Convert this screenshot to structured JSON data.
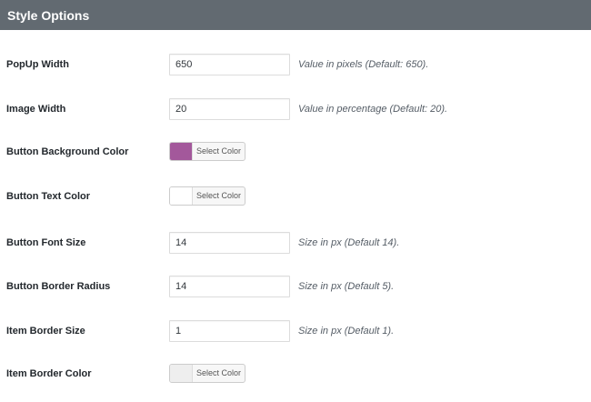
{
  "header": {
    "title": "Style Options"
  },
  "fields": [
    {
      "label": "PopUp Width",
      "type": "text",
      "value": "650",
      "description": "Value in pixels (Default: 650)."
    },
    {
      "label": "Image Width",
      "type": "text",
      "value": "20",
      "description": "Value in percentage (Default: 20)."
    },
    {
      "label": "Button Background Color",
      "type": "color",
      "color": "#a3589b",
      "button_label": "Select Color"
    },
    {
      "label": "Button Text Color",
      "type": "color",
      "color": "#ffffff",
      "button_label": "Select Color"
    },
    {
      "label": "Button Font Size",
      "type": "text",
      "value": "14",
      "description": "Size in px (Default 14)."
    },
    {
      "label": "Button Border Radius",
      "type": "text",
      "value": "14",
      "description": "Size in px (Default 5)."
    },
    {
      "label": "Item Border Size",
      "type": "text",
      "value": "1",
      "description": "Size in px (Default 1)."
    },
    {
      "label": "Item Border Color",
      "type": "color",
      "color": "#eeeeee",
      "button_label": "Select Color"
    }
  ],
  "colors": {
    "header_bg": "#626a71",
    "label_text": "#23282d",
    "description_text": "#555d66"
  }
}
